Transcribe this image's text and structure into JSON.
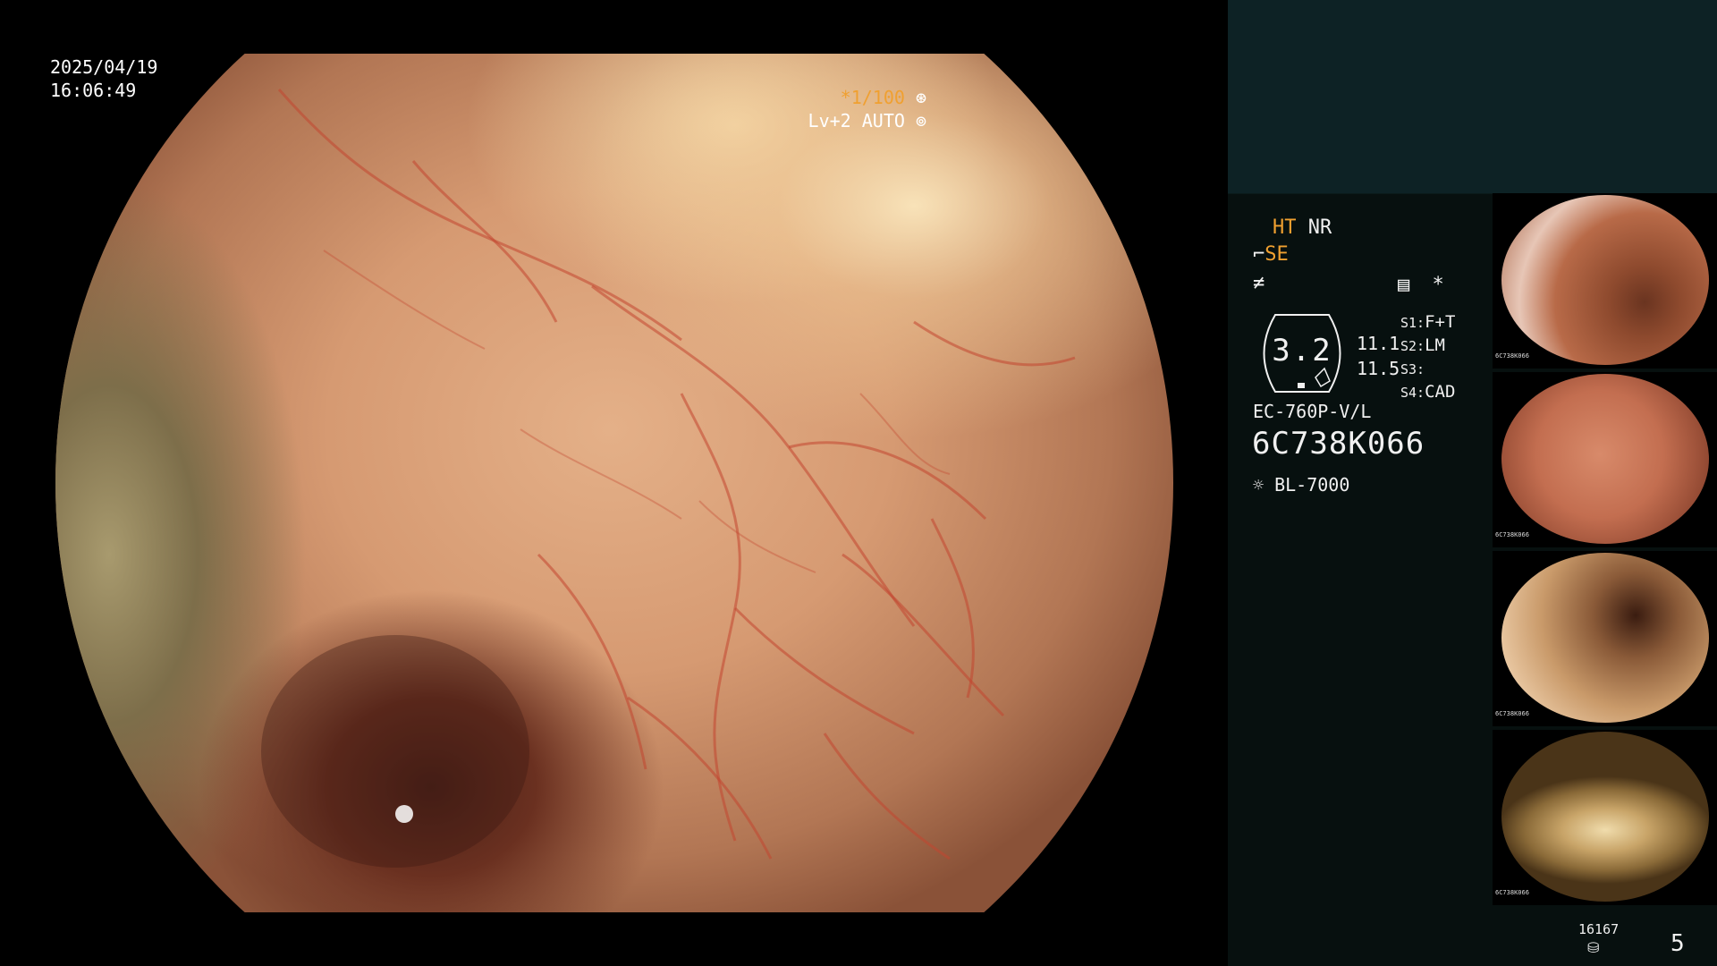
{
  "main": {
    "date": "2025/04/19",
    "time": "16:06:49",
    "shutter": "*1/100",
    "shutter_icon": "aperture-icon",
    "level": "Lv+2 AUTO",
    "level_icon": "iris-icon"
  },
  "panel": {
    "mode_ht": "HT",
    "mode_nr": "NR",
    "mode_se": "SE",
    "se_icon": "probe-icon",
    "flash_icon": "freeze-icon",
    "menu_icon": "settings-list-icon",
    "star": "*",
    "gauge_value": "3.2",
    "ratio_1": "11.1",
    "ratio_2": "11.5",
    "slots": [
      {
        "key": "S1:",
        "value": "F+T"
      },
      {
        "key": "S2:",
        "value": "LM"
      },
      {
        "key": "S3:",
        "value": ""
      },
      {
        "key": "S4:",
        "value": "CAD"
      }
    ],
    "model": "EC-760P-V/L",
    "serial": "6C738K066",
    "light_source": "BL-7000",
    "light_icon": "lamp-icon"
  },
  "thumbnails": [
    {
      "serial": "6C738K066"
    },
    {
      "serial": "6C738K066"
    },
    {
      "serial": "6C738K066"
    },
    {
      "serial": "6C738K066"
    }
  ],
  "footer": {
    "count": "16167",
    "storage_icon": "storage-icon",
    "page": "5"
  },
  "colors": {
    "accent": "#f0a030",
    "panel_bg": "#07100f",
    "panel_top": "#0d2225"
  }
}
